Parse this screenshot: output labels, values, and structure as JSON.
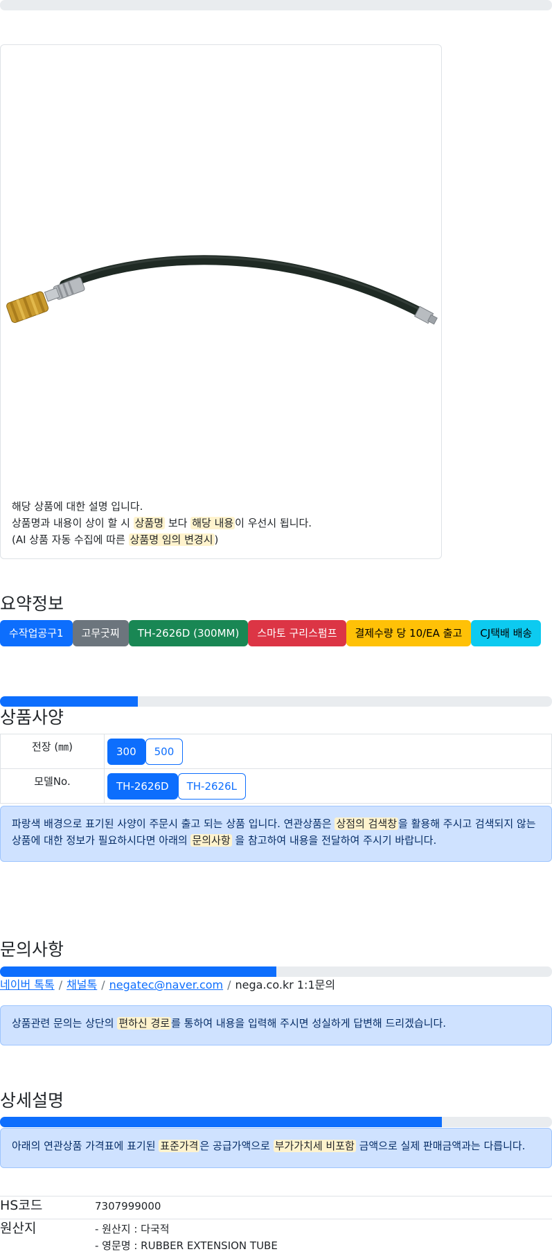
{
  "card": {
    "image_alt": "grease hose product image",
    "desc_line1": "해당 상품에 대한 설명 입니다.",
    "desc_line2_pre": "상품명과 내용이 상이 할 시 ",
    "desc_line2_mark1": "상품명",
    "desc_line2_mid": " 보다 ",
    "desc_line2_mark2": "해당 내용",
    "desc_line2_post": "이 우선시 됩니다.",
    "desc_line3_pre": "(AI 상품 자동 수집에 따른 ",
    "desc_line3_mark": "상품명 임의 변경시",
    "desc_line3_post": ")"
  },
  "summary": {
    "title": "요약정보",
    "badges": [
      {
        "label": "수작업공구1",
        "bg": "#0d6efd",
        "fg": "#ffffff"
      },
      {
        "label": "고무굿찌",
        "bg": "#6c757d",
        "fg": "#ffffff"
      },
      {
        "label": "TH-2626D (300MM)",
        "bg": "#198754",
        "fg": "#ffffff"
      },
      {
        "label": "스마토 구리스펌프",
        "bg": "#dc3545",
        "fg": "#ffffff"
      },
      {
        "label": "결제수량 당 10/EA 출고",
        "bg": "#ffc107",
        "fg": "#000000"
      },
      {
        "label": "CJ택배 배송",
        "bg": "#0dcaf0",
        "fg": "#000000"
      }
    ]
  },
  "spec": {
    "progress": 25,
    "title": "상품사양",
    "rows": [
      {
        "label": "전장 (㎜)",
        "options": [
          "300",
          "500"
        ],
        "selected": 0
      },
      {
        "label": "모델No.",
        "options": [
          "TH-2626D",
          "TH-2626L"
        ],
        "selected": 0
      }
    ],
    "notice_pre": "파랑색 배경으로 표기된 사양이 주문시 출고 되는 상품 입니다. 연관상품은 ",
    "notice_mark1": "상점의 검색창",
    "notice_mid": "을 활용해 주시고 검색되지 않는 상품에 대한 정보가 필요하시다면 아래의 ",
    "notice_mark2": "문의사항",
    "notice_post": " 을 참고하여 내용을 전달하여 주시기 바랍니다."
  },
  "inquiry": {
    "title": "문의사항",
    "progress": 50,
    "link_naver": "네이버 톡톡",
    "link_channel": "채널톡",
    "link_email": "negatec@naver.com",
    "sep": "/",
    "site_text": "nega.co.kr 1:1문의",
    "notice_pre": "상품관련 문의는 상단의 ",
    "notice_mark": "편하신 경로",
    "notice_post": "를 통하여 내용을 입력해 주시면 성실하게 답변해 드리겠습니다."
  },
  "detail": {
    "title": "상세설명",
    "progress": 80,
    "notice_pre": "아래의 연관상품 가격표에 표기된 ",
    "notice_mark1": "표준가격",
    "notice_mid": "은 공급가액으로 ",
    "notice_mark2": "부가가치세 비포함",
    "notice_post": " 금액으로 실제 판매금액과는 다릅니다."
  },
  "info": {
    "hs_label": "HS코드",
    "hs_value": "7307999000",
    "origin_label": "원산지",
    "origin_line1": "- 원산지 : 다국적",
    "origin_line2": "- 영문명 : RUBBER EXTENSION TUBE"
  }
}
